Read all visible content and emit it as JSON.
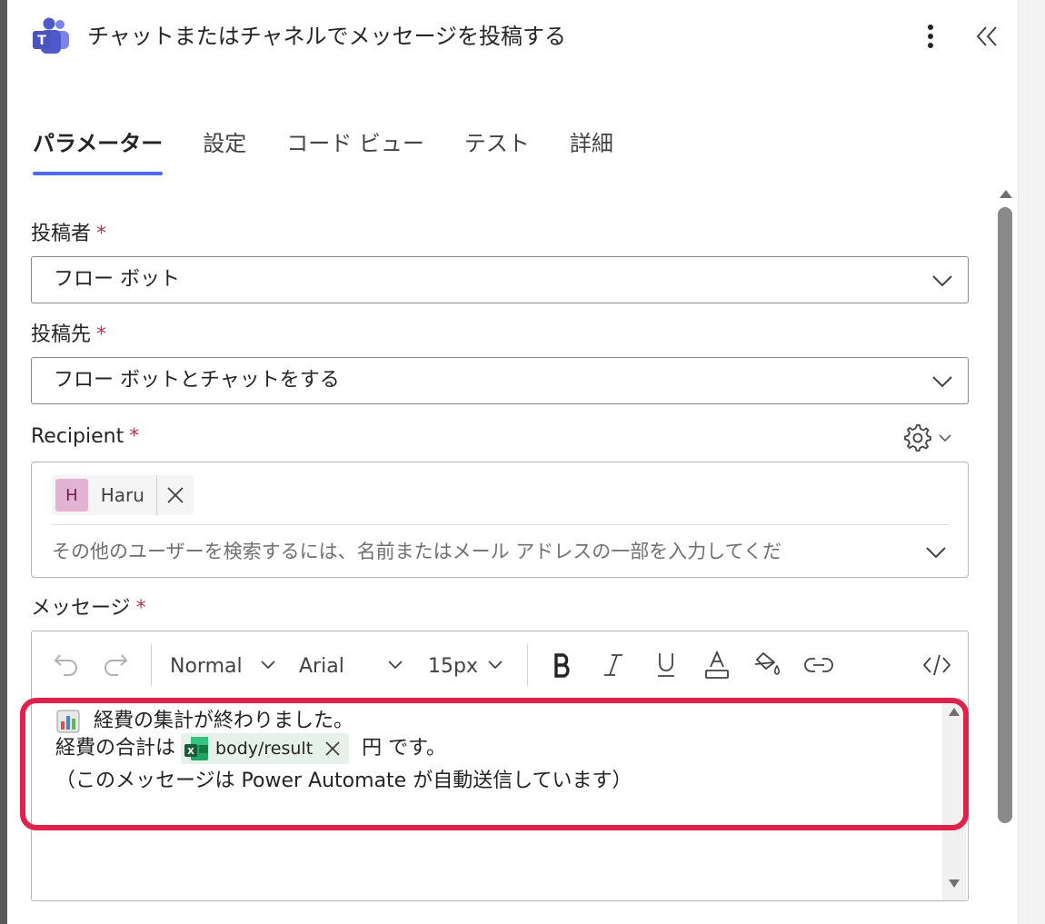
{
  "header": {
    "title": "チャットまたはチャネルでメッセージを投稿する",
    "app_icon": "microsoft-teams-icon",
    "more_icon": "more-vertical-icon",
    "collapse_icon": "chevron-double-left-icon"
  },
  "tabs": [
    {
      "label": "パラメーター",
      "active": true
    },
    {
      "label": "設定",
      "active": false
    },
    {
      "label": "コード ビュー",
      "active": false
    },
    {
      "label": "テスト",
      "active": false
    },
    {
      "label": "詳細",
      "active": false
    }
  ],
  "fields": {
    "post_as": {
      "label": "投稿者",
      "required_mark": "*",
      "value": "フロー ボット"
    },
    "post_in": {
      "label": "投稿先",
      "required_mark": "*",
      "value": "フロー ボットとチャットをする"
    },
    "recipient": {
      "label": "Recipient",
      "required_mark": "*",
      "chip": {
        "initial": "H",
        "name": "Haru"
      },
      "placeholder": "その他のユーザーを検索するには、名前またはメール アドレスの一部を入力してくだ"
    },
    "message": {
      "label": "メッセージ",
      "required_mark": "*",
      "toolbar": {
        "format": "Normal",
        "font": "Arial",
        "size": "15px"
      },
      "line1": "経費の集計が終わりました。",
      "line2_prefix": "経費の合計は",
      "token_label": "body/result",
      "line2_suffix": "円 です。",
      "line3": "（このメッセージは Power Automate が自動送信しています）"
    }
  },
  "colors": {
    "accent": "#4f6bed",
    "required": "#c4314b",
    "highlight": "#e0224b",
    "token_bg": "#e6f1ea"
  }
}
